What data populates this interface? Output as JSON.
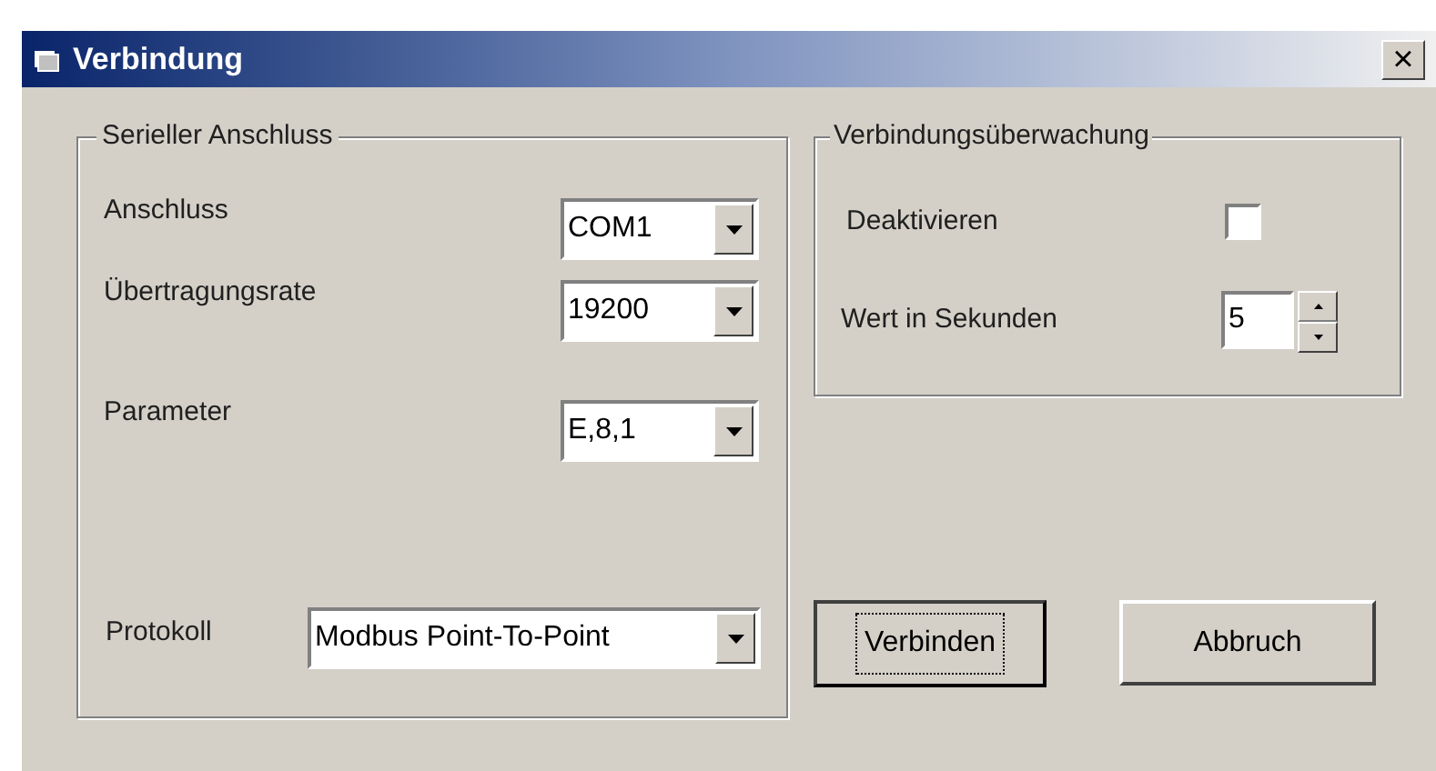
{
  "window": {
    "title": "Verbindung",
    "close": "×"
  },
  "serial_group": {
    "title": "Serieller Anschluss",
    "fields": [
      {
        "label": "Anschluss",
        "value": "COM1"
      },
      {
        "label": "Übertragungsrate",
        "value": "19200"
      },
      {
        "label": "Parameter",
        "value": "E,8,1"
      }
    ],
    "protocol": {
      "label": "Protokoll",
      "value": "Modbus Point-To-Point"
    }
  },
  "monitor_group": {
    "title": "Verbindungsüberwachung",
    "disable": {
      "label": "Deaktivieren",
      "checked": false
    },
    "seconds": {
      "label": "Wert in Sekunden",
      "value": "5"
    }
  },
  "buttons": [
    {
      "label": "Verbinden",
      "focused": true
    },
    {
      "label": "Abbruch",
      "focused": false
    }
  ]
}
